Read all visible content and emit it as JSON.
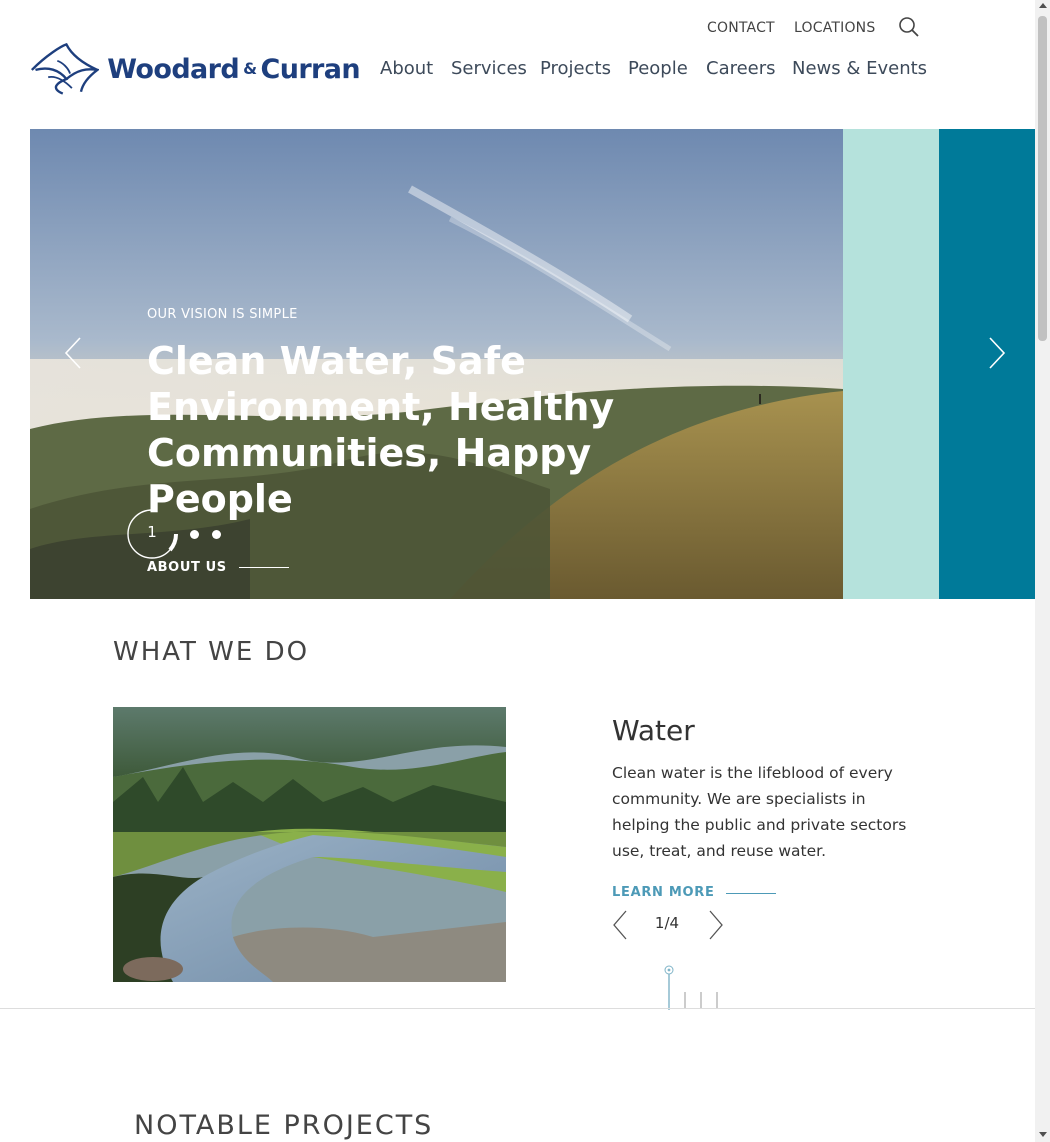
{
  "header": {
    "utility": {
      "contact": "CONTACT",
      "locations": "LOCATIONS"
    },
    "logo": {
      "name": "Woodard",
      "amp": "&",
      "name2": "Curran"
    },
    "nav": [
      "About",
      "Services",
      "Projects",
      "People",
      "Careers",
      "News & Events"
    ]
  },
  "hero": {
    "eyebrow": "OUR VISION IS SIMPLE",
    "title": "Clean Water, Safe Environment, Healthy Communities, Happy People",
    "slide_number": "1",
    "cta": "ABOUT US",
    "slide_count_dots": 2
  },
  "what_we_do": {
    "title": "WHAT WE DO",
    "heading": "Water",
    "description": "Clean water is the lifeblood of every community. We are specialists in helping the public and private sectors use, treat, and reuse water.",
    "cta": "LEARN MORE",
    "pager": "1/4"
  },
  "notable_projects": {
    "title": "NOTABLE PROJECTS"
  },
  "colors": {
    "brand_navy": "#1e3f7e",
    "panel_mint": "#b5e2dc",
    "panel_teal": "#007a99",
    "link_blue": "#4d9ab7"
  }
}
